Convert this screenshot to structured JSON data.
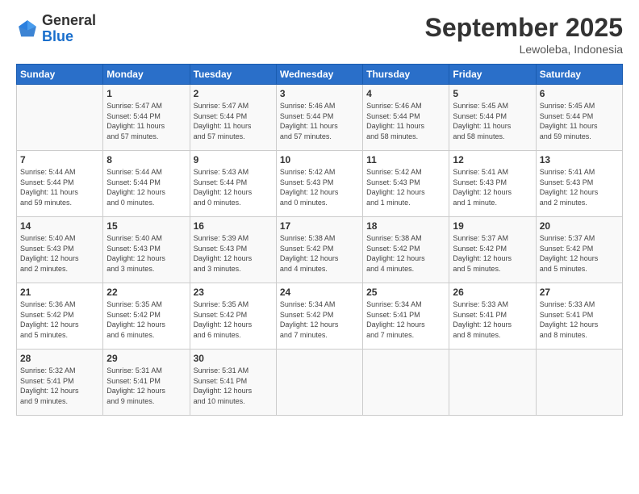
{
  "header": {
    "logo_general": "General",
    "logo_blue": "Blue",
    "month_title": "September 2025",
    "location": "Lewoleba, Indonesia"
  },
  "days_of_week": [
    "Sunday",
    "Monday",
    "Tuesday",
    "Wednesday",
    "Thursday",
    "Friday",
    "Saturday"
  ],
  "weeks": [
    [
      {
        "day": "",
        "info": ""
      },
      {
        "day": "1",
        "info": "Sunrise: 5:47 AM\nSunset: 5:44 PM\nDaylight: 11 hours\nand 57 minutes."
      },
      {
        "day": "2",
        "info": "Sunrise: 5:47 AM\nSunset: 5:44 PM\nDaylight: 11 hours\nand 57 minutes."
      },
      {
        "day": "3",
        "info": "Sunrise: 5:46 AM\nSunset: 5:44 PM\nDaylight: 11 hours\nand 57 minutes."
      },
      {
        "day": "4",
        "info": "Sunrise: 5:46 AM\nSunset: 5:44 PM\nDaylight: 11 hours\nand 58 minutes."
      },
      {
        "day": "5",
        "info": "Sunrise: 5:45 AM\nSunset: 5:44 PM\nDaylight: 11 hours\nand 58 minutes."
      },
      {
        "day": "6",
        "info": "Sunrise: 5:45 AM\nSunset: 5:44 PM\nDaylight: 11 hours\nand 59 minutes."
      }
    ],
    [
      {
        "day": "7",
        "info": "Sunrise: 5:44 AM\nSunset: 5:44 PM\nDaylight: 11 hours\nand 59 minutes."
      },
      {
        "day": "8",
        "info": "Sunrise: 5:44 AM\nSunset: 5:44 PM\nDaylight: 12 hours\nand 0 minutes."
      },
      {
        "day": "9",
        "info": "Sunrise: 5:43 AM\nSunset: 5:44 PM\nDaylight: 12 hours\nand 0 minutes."
      },
      {
        "day": "10",
        "info": "Sunrise: 5:42 AM\nSunset: 5:43 PM\nDaylight: 12 hours\nand 0 minutes."
      },
      {
        "day": "11",
        "info": "Sunrise: 5:42 AM\nSunset: 5:43 PM\nDaylight: 12 hours\nand 1 minute."
      },
      {
        "day": "12",
        "info": "Sunrise: 5:41 AM\nSunset: 5:43 PM\nDaylight: 12 hours\nand 1 minute."
      },
      {
        "day": "13",
        "info": "Sunrise: 5:41 AM\nSunset: 5:43 PM\nDaylight: 12 hours\nand 2 minutes."
      }
    ],
    [
      {
        "day": "14",
        "info": "Sunrise: 5:40 AM\nSunset: 5:43 PM\nDaylight: 12 hours\nand 2 minutes."
      },
      {
        "day": "15",
        "info": "Sunrise: 5:40 AM\nSunset: 5:43 PM\nDaylight: 12 hours\nand 3 minutes."
      },
      {
        "day": "16",
        "info": "Sunrise: 5:39 AM\nSunset: 5:43 PM\nDaylight: 12 hours\nand 3 minutes."
      },
      {
        "day": "17",
        "info": "Sunrise: 5:38 AM\nSunset: 5:42 PM\nDaylight: 12 hours\nand 4 minutes."
      },
      {
        "day": "18",
        "info": "Sunrise: 5:38 AM\nSunset: 5:42 PM\nDaylight: 12 hours\nand 4 minutes."
      },
      {
        "day": "19",
        "info": "Sunrise: 5:37 AM\nSunset: 5:42 PM\nDaylight: 12 hours\nand 5 minutes."
      },
      {
        "day": "20",
        "info": "Sunrise: 5:37 AM\nSunset: 5:42 PM\nDaylight: 12 hours\nand 5 minutes."
      }
    ],
    [
      {
        "day": "21",
        "info": "Sunrise: 5:36 AM\nSunset: 5:42 PM\nDaylight: 12 hours\nand 5 minutes."
      },
      {
        "day": "22",
        "info": "Sunrise: 5:35 AM\nSunset: 5:42 PM\nDaylight: 12 hours\nand 6 minutes."
      },
      {
        "day": "23",
        "info": "Sunrise: 5:35 AM\nSunset: 5:42 PM\nDaylight: 12 hours\nand 6 minutes."
      },
      {
        "day": "24",
        "info": "Sunrise: 5:34 AM\nSunset: 5:42 PM\nDaylight: 12 hours\nand 7 minutes."
      },
      {
        "day": "25",
        "info": "Sunrise: 5:34 AM\nSunset: 5:41 PM\nDaylight: 12 hours\nand 7 minutes."
      },
      {
        "day": "26",
        "info": "Sunrise: 5:33 AM\nSunset: 5:41 PM\nDaylight: 12 hours\nand 8 minutes."
      },
      {
        "day": "27",
        "info": "Sunrise: 5:33 AM\nSunset: 5:41 PM\nDaylight: 12 hours\nand 8 minutes."
      }
    ],
    [
      {
        "day": "28",
        "info": "Sunrise: 5:32 AM\nSunset: 5:41 PM\nDaylight: 12 hours\nand 9 minutes."
      },
      {
        "day": "29",
        "info": "Sunrise: 5:31 AM\nSunset: 5:41 PM\nDaylight: 12 hours\nand 9 minutes."
      },
      {
        "day": "30",
        "info": "Sunrise: 5:31 AM\nSunset: 5:41 PM\nDaylight: 12 hours\nand 10 minutes."
      },
      {
        "day": "",
        "info": ""
      },
      {
        "day": "",
        "info": ""
      },
      {
        "day": "",
        "info": ""
      },
      {
        "day": "",
        "info": ""
      }
    ]
  ]
}
